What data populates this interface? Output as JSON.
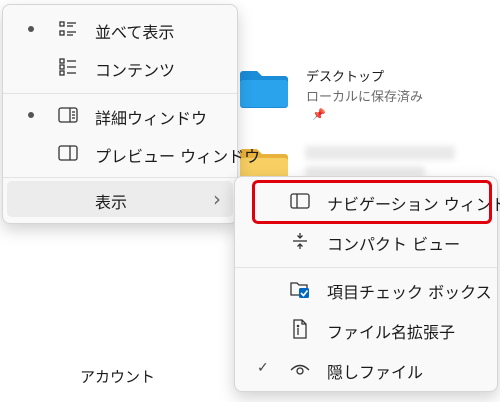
{
  "background": {
    "desktop_title": "デスクトップ",
    "desktop_sub": "ローカルに保存済み",
    "account": "アカウント",
    "folder_blue": "#1a8cd8",
    "folder_yellow": "#f2c14e"
  },
  "view_menu": {
    "items": [
      {
        "label": "並べて表示",
        "icon": "tiles-icon",
        "selected": true
      },
      {
        "label": "コンテンツ",
        "icon": "content-icon",
        "selected": false
      },
      {
        "label": "詳細ウィンドウ",
        "icon": "details-pane-icon",
        "selected": true
      },
      {
        "label": "プレビュー ウィンドウ",
        "icon": "preview-pane-icon",
        "selected": false
      }
    ],
    "show_label": "表示",
    "show_chevron": "›"
  },
  "show_submenu": {
    "items": [
      {
        "label": "ナビゲーション ウィンドウ",
        "icon": "navigation-pane-icon",
        "checked": false,
        "highlighted": true
      },
      {
        "label": "コンパクト ビュー",
        "icon": "compact-view-icon",
        "checked": false
      },
      {
        "label": "項目チェック ボックス",
        "icon": "item-checkbox-icon",
        "checked": false
      },
      {
        "label": "ファイル名拡張子",
        "icon": "file-extension-icon",
        "checked": false
      },
      {
        "label": "隠しファイル",
        "icon": "eye-icon",
        "checked": true
      }
    ],
    "check_glyph": "✓",
    "highlight_color": "#e0000b",
    "accent_color": "#0067c0"
  }
}
